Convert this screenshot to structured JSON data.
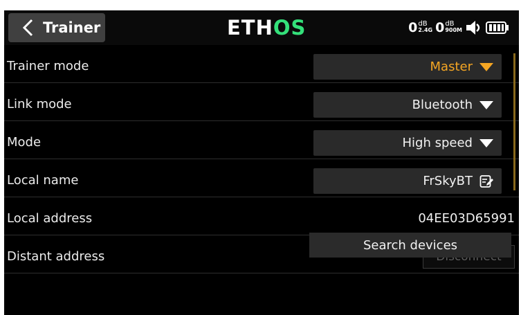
{
  "header": {
    "back_icon": "chevron-left-icon",
    "title": "Trainer",
    "logo_part1": "ETH",
    "logo_part2": "OS",
    "logo_accent_color": "#34e07a",
    "rssi": [
      {
        "value": "0",
        "unit": "dB",
        "band": "2.4G"
      },
      {
        "value": "0",
        "unit": "dB",
        "band": "900M"
      }
    ],
    "volume_icon": "speaker-icon",
    "battery_icon": "battery-full-icon"
  },
  "settings": [
    {
      "label": "Trainer mode",
      "value": "Master",
      "control": "dropdown",
      "accent": true
    },
    {
      "label": "Link mode",
      "value": "Bluetooth",
      "control": "dropdown"
    },
    {
      "label": "Mode",
      "value": "High speed",
      "control": "dropdown"
    },
    {
      "label": "Local name",
      "value": "FrSkyBT",
      "control": "text-edit"
    },
    {
      "label": "Local address",
      "value": "04EE03D65991",
      "control": "static"
    },
    {
      "label": "Distant address",
      "button_label": "Disconnect",
      "button_enabled": false
    }
  ],
  "search_button_label": "Search devices",
  "colors": {
    "accent": "#f5a623",
    "field_bg": "#2a2a2a",
    "background": "#000000"
  }
}
